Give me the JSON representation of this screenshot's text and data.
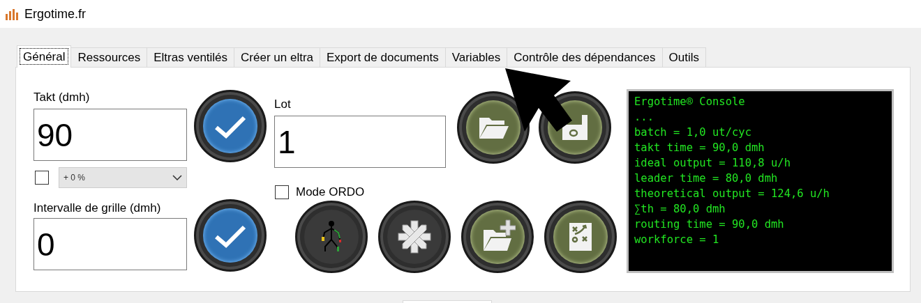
{
  "window": {
    "title": "Ergotime.fr"
  },
  "tabs": [
    {
      "label": "Général",
      "selected": true
    },
    {
      "label": "Ressources",
      "selected": false
    },
    {
      "label": "Eltras ventilés",
      "selected": false
    },
    {
      "label": "Créer un eltra",
      "selected": false
    },
    {
      "label": "Export de documents",
      "selected": false
    },
    {
      "label": "Variables",
      "selected": false
    },
    {
      "label": "Contrôle des dépendances",
      "selected": false
    },
    {
      "label": "Outils",
      "selected": false
    }
  ],
  "takt": {
    "label": "Takt (dmh)",
    "value": "90"
  },
  "takt_margin": {
    "checked": false,
    "value": "+ 0 %"
  },
  "grid_interval": {
    "label": "Intervalle de grille (dmh)",
    "value": "0"
  },
  "lot": {
    "label": "Lot",
    "value": "1"
  },
  "mode_ordo": {
    "label": "Mode ORDO",
    "checked": false
  },
  "console": {
    "lines": [
      "Ergotime® Console",
      "...",
      "batch = 1,0 ut/cyc",
      "takt time = 90,0 dmh",
      "ideal output = 110,8 u/h",
      "leader time = 80,0 dmh",
      "theoretical output = 124,6 u/h",
      "∑th = 80,0 dmh",
      "routing time = 90,0 dmh",
      "workforce = 1"
    ]
  }
}
